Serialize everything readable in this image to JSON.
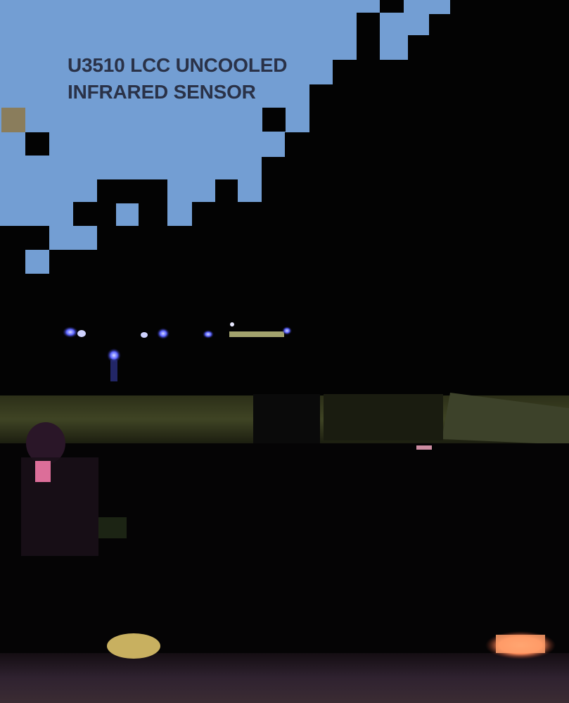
{
  "caption": {
    "line1": "U3510 LCC UNCOOLED",
    "line2": "INFRARED SENSOR"
  },
  "colors": {
    "sky_blue": "#739ed3",
    "caption_text": "#2a3248",
    "background": "#030303",
    "road_stripe": "#3a3f1f",
    "ground": "#2a1f29"
  }
}
